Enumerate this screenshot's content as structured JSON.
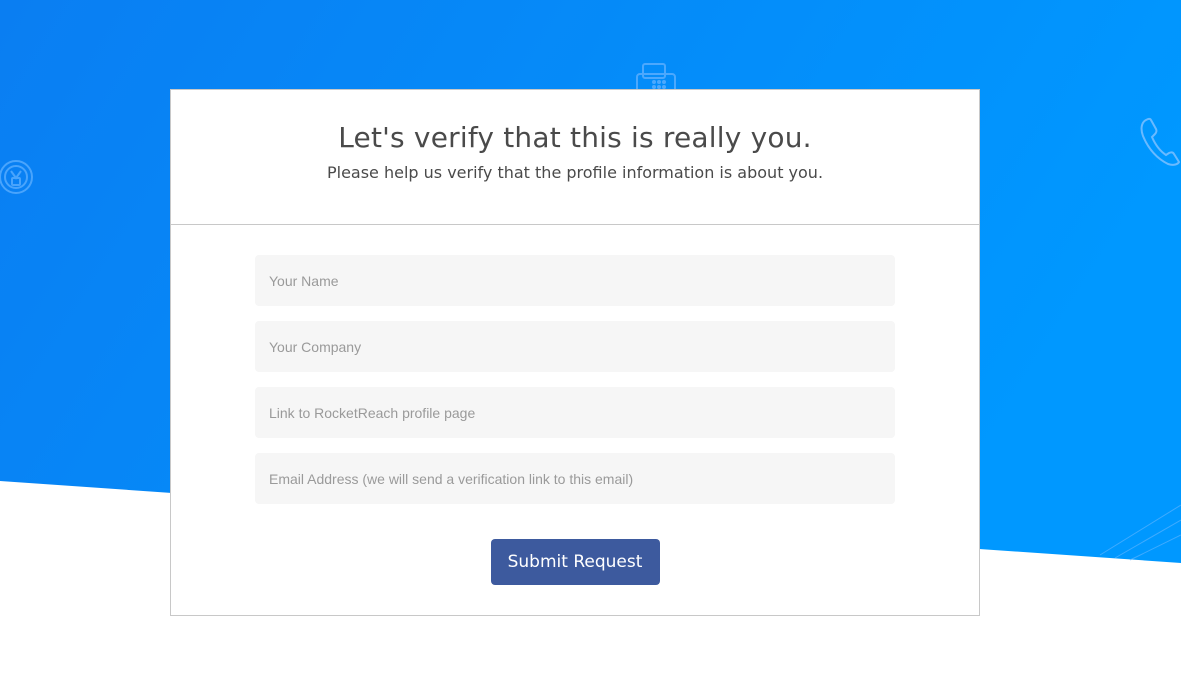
{
  "header": {
    "title": "Let's verify that this is really you.",
    "subtitle": "Please help us verify that the profile information is about you."
  },
  "form": {
    "name_placeholder": "Your Name",
    "company_placeholder": "Your Company",
    "profile_link_placeholder": "Link to RocketReach profile page",
    "email_placeholder": "Email Address (we will send a verification link to this email)",
    "submit_label": "Submit Request"
  },
  "icons": {
    "fax": "fax-icon",
    "phone": "phone-icon",
    "badge": "medal-badge-icon"
  },
  "colors": {
    "background_blue_left": "#0a7ef2",
    "background_blue_right": "#0096ff",
    "button": "#3d5a9e",
    "field_bg": "#f6f6f6",
    "text": "#4a4a4a"
  }
}
